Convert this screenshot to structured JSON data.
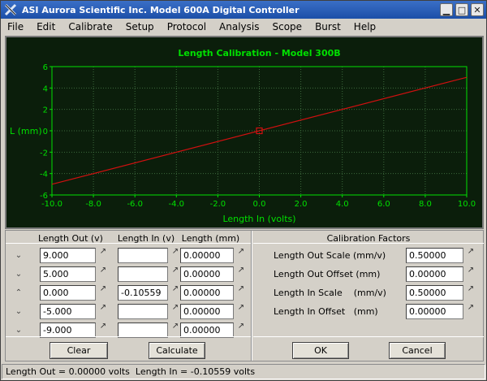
{
  "window": {
    "title": "ASI Aurora Scientific Inc.  Model 600A Digital Controller",
    "icon": "x-logo-icon",
    "controls": {
      "minimize": "▁",
      "maximize": "□",
      "close": "✕"
    }
  },
  "menu": [
    "File",
    "Edit",
    "Calibrate",
    "Setup",
    "Protocol",
    "Analysis",
    "Scope",
    "Burst",
    "Help"
  ],
  "chart_data": {
    "type": "line",
    "title": "Length Calibration  - Model 300B",
    "xlabel": "Length In (volts)",
    "ylabel": "L (mm)",
    "xlim": [
      -10,
      10
    ],
    "ylim": [
      -6,
      6
    ],
    "x_ticks": [
      "-10.0",
      "-8.0",
      "-6.0",
      "-4.0",
      "-2.0",
      "0.0",
      "2.0",
      "4.0",
      "6.0",
      "8.0",
      "10.0"
    ],
    "y_ticks": [
      "-6",
      "-4",
      "-2",
      "0",
      "2",
      "4",
      "6"
    ],
    "grid": true,
    "series": [
      {
        "color": "#d01010",
        "x": [
          -10,
          10
        ],
        "y": [
          -5,
          5
        ]
      }
    ],
    "marker": {
      "x": 0,
      "y": 0,
      "shape": "square",
      "color": "#d01010"
    },
    "colors": {
      "background": "#0b1e0b",
      "axis_text": "#00e000",
      "grid": "#3c6a3c"
    }
  },
  "table": {
    "headers": [
      "Length Out (v)",
      "Length In (v)",
      "Length (mm)"
    ],
    "rows": [
      {
        "arrow": "⌄",
        "out": "9.000",
        "in": "",
        "mm": "0.00000"
      },
      {
        "arrow": "⌄",
        "out": "5.000",
        "in": "",
        "mm": "0.00000"
      },
      {
        "arrow": "⌃",
        "out": "0.000",
        "in": "-0.10559",
        "mm": "0.00000"
      },
      {
        "arrow": "⌄",
        "out": "-5.000",
        "in": "",
        "mm": "0.00000"
      },
      {
        "arrow": "⌄",
        "out": "-9.000",
        "in": "",
        "mm": "0.00000"
      }
    ],
    "spin_glyph": "↗"
  },
  "factors": {
    "heading": "Calibration Factors",
    "items": [
      {
        "label": "Length Out Scale (mm/v)",
        "value": "0.50000"
      },
      {
        "label": "Length Out Offset (mm)",
        "value": "0.00000"
      },
      {
        "label": "Length In Scale    (mm/v)",
        "value": "0.50000"
      },
      {
        "label": "Length In Offset   (mm)",
        "value": "0.00000"
      }
    ]
  },
  "buttons": {
    "clear": "Clear",
    "calculate": "Calculate",
    "ok": "OK",
    "cancel": "Cancel"
  },
  "status": "Length Out = 0.00000 volts  Length In = -0.10559 volts"
}
